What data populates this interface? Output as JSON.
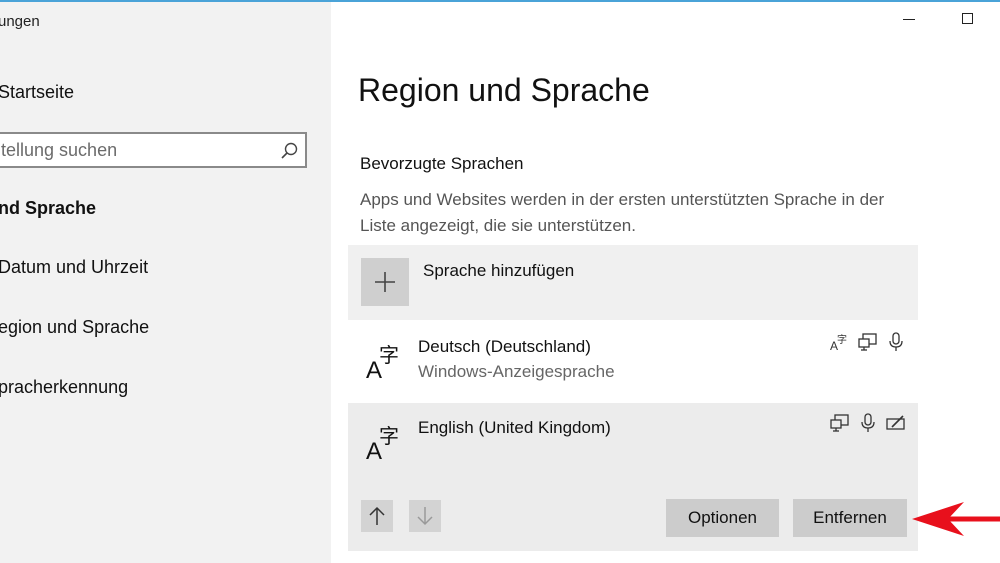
{
  "window": {
    "title": "ungen"
  },
  "sidebar": {
    "home_label": "Startseite",
    "search_placeholder": "tellung suchen",
    "section_title": "nd Sprache",
    "items": [
      {
        "label": "Datum und Uhrzeit"
      },
      {
        "label": "egion und Sprache"
      },
      {
        "label": "pracherkennung"
      }
    ]
  },
  "main": {
    "page_title": "Region und Sprache",
    "preferred_heading": "Bevorzugte Sprachen",
    "description": "Apps und Websites werden in der ersten unterstützten Sprache in der Liste angezeigt, die sie unterstützen.",
    "add_language_label": "Sprache hinzufügen",
    "languages": [
      {
        "name": "Deutsch (Deutschland)",
        "subtitle": "Windows-Anzeigesprache",
        "features": [
          "language-pack-icon",
          "display-language-icon",
          "speech-icon"
        ]
      },
      {
        "name": "English (United Kingdom)",
        "features": [
          "display-language-icon",
          "speech-icon",
          "handwriting-icon"
        ]
      }
    ],
    "options_button": "Optionen",
    "remove_button": "Entfernen"
  },
  "colors": {
    "sidebar_bg": "#f2f2f2",
    "add_row_bg": "#f0f0f0",
    "selected_row_bg": "#ececec",
    "button_bg": "#cccccc",
    "annotation_arrow": "#e8101c",
    "top_accent": "#4aa3d8"
  }
}
